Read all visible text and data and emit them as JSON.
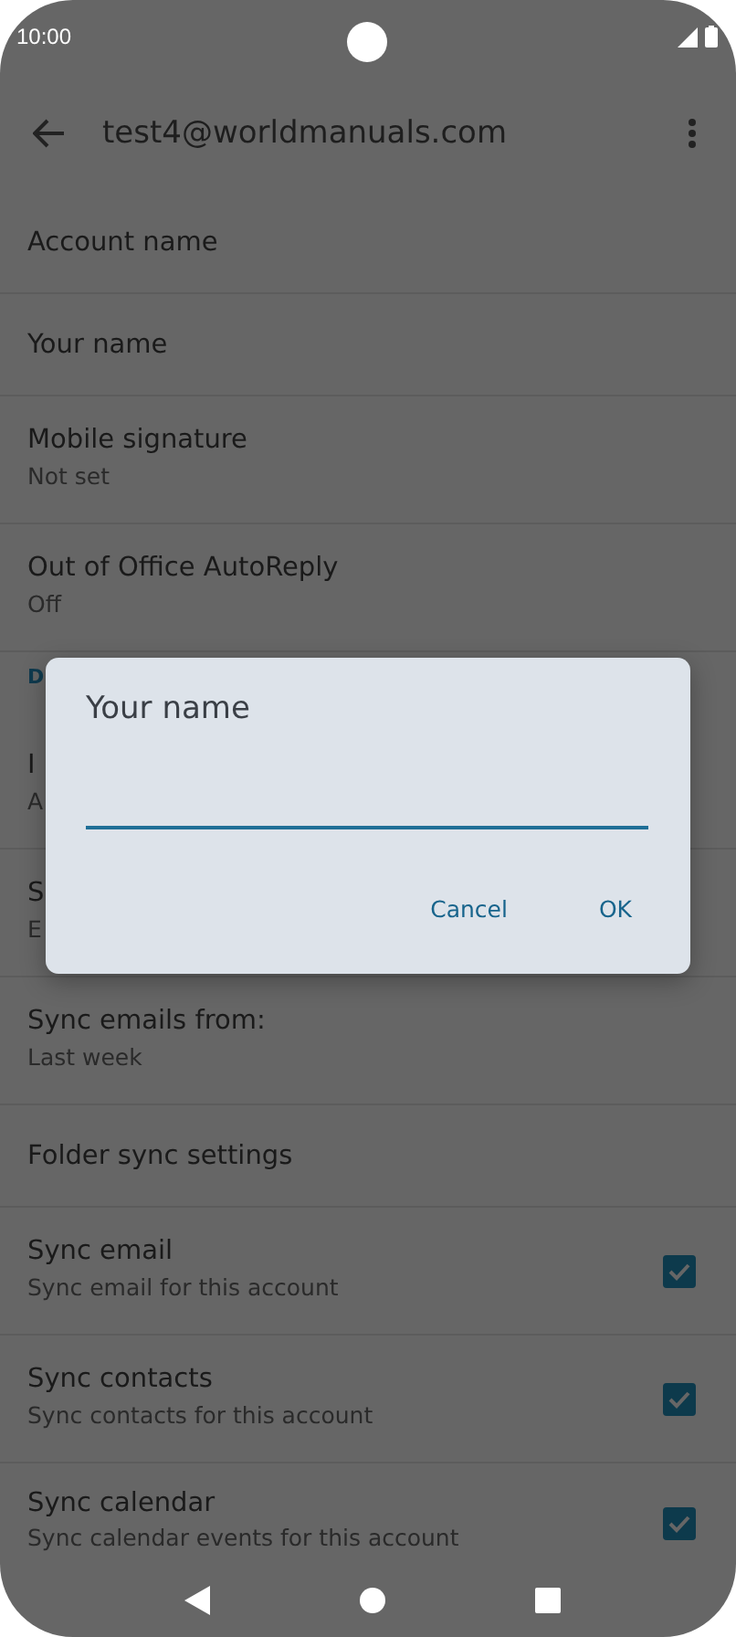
{
  "status_bar": {
    "time": "10:00"
  },
  "app_bar": {
    "title": "test4@worldmanuals.com"
  },
  "settings": [
    {
      "kind": "item",
      "title": "Account name"
    },
    {
      "kind": "item",
      "title": "Your name"
    },
    {
      "kind": "item",
      "title": "Mobile signature",
      "summary": "Not set"
    },
    {
      "kind": "item",
      "title": "Out of Office AutoReply",
      "summary": "Off"
    },
    {
      "kind": "header",
      "title": "D"
    },
    {
      "kind": "item",
      "title": "I",
      "summary": "A"
    },
    {
      "kind": "item",
      "title": "S",
      "summary": "E"
    },
    {
      "kind": "item",
      "title": "Sync emails from:",
      "summary": "Last week"
    },
    {
      "kind": "item",
      "title": "Folder sync settings"
    },
    {
      "kind": "check",
      "title": "Sync email",
      "summary": "Sync email for this account",
      "checked": true
    },
    {
      "kind": "check",
      "title": "Sync contacts",
      "summary": "Sync contacts for this account",
      "checked": true
    },
    {
      "kind": "check",
      "title": "Sync calendar",
      "summary": "Sync calendar events for this account",
      "checked": true
    }
  ],
  "dialog": {
    "title": "Your name",
    "buttons": [
      "Cancel",
      "OK"
    ]
  }
}
